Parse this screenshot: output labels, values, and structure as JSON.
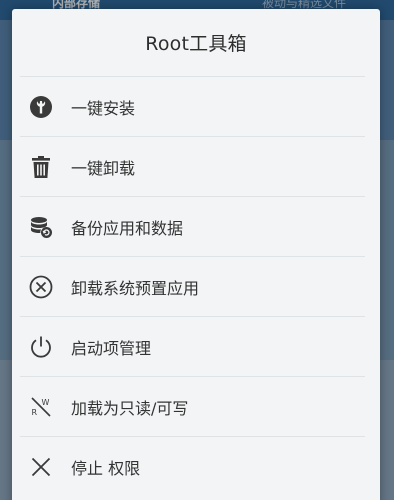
{
  "background": {
    "left_tab": "内部存储",
    "right_tab": "被动与精选文件"
  },
  "dialog": {
    "title": "Root工具箱",
    "items": [
      {
        "label": "一键安装",
        "icon": "wrench-icon"
      },
      {
        "label": "一键卸载",
        "icon": "trash-icon"
      },
      {
        "label": "备份应用和数据",
        "icon": "database-backup-icon"
      },
      {
        "label": "卸载系统预置应用",
        "icon": "circle-x-icon"
      },
      {
        "label": "启动项管理",
        "icon": "power-icon"
      },
      {
        "label": "加载为只读/可写",
        "icon": "rw-icon"
      },
      {
        "label": "停止 权限",
        "icon": "close-icon"
      }
    ]
  },
  "colors": {
    "dialog_bg": "#f2f4f6",
    "text": "#333333",
    "icon": "#3a3a3a",
    "divider": "#dfe3e6"
  }
}
